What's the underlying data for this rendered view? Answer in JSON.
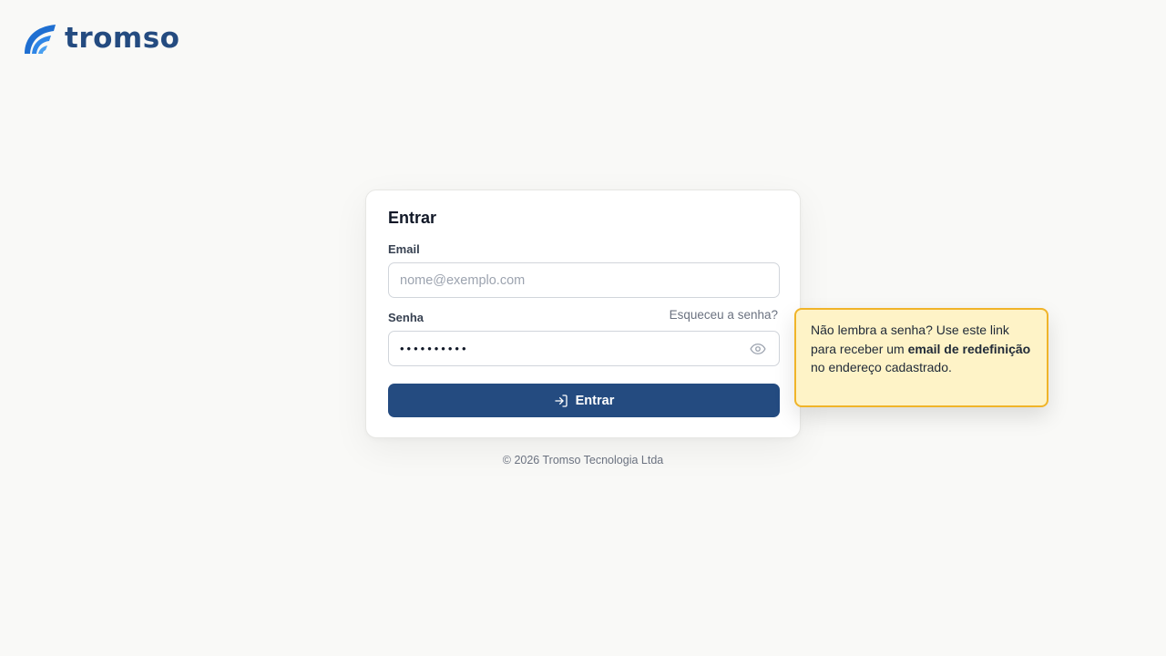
{
  "brand": {
    "name": "tromso",
    "primary_color": "#244b80",
    "logo_accent_color": "#1f6fd1"
  },
  "login": {
    "title": "Entrar",
    "email_label": "Email",
    "email_value": "",
    "email_placeholder": "nome@exemplo.com",
    "password_label": "Senha",
    "password_value": "••••••••••",
    "forgot_link": "Esqueceu a senha?",
    "show_password_icon": "eye-icon",
    "submit_icon": "login-arrow-icon",
    "submit_label": "Entrar"
  },
  "footer": {
    "copyright": "© 2026 Tromso Tecnologia Ltda"
  },
  "tooltip": {
    "text_before": "Não lembra a senha? Use este link para receber um ",
    "text_bold": "email de redefinição",
    "text_after": " no endereço cadastrado.",
    "background_color": "#fef3c7",
    "border_color": "#f0b429"
  }
}
